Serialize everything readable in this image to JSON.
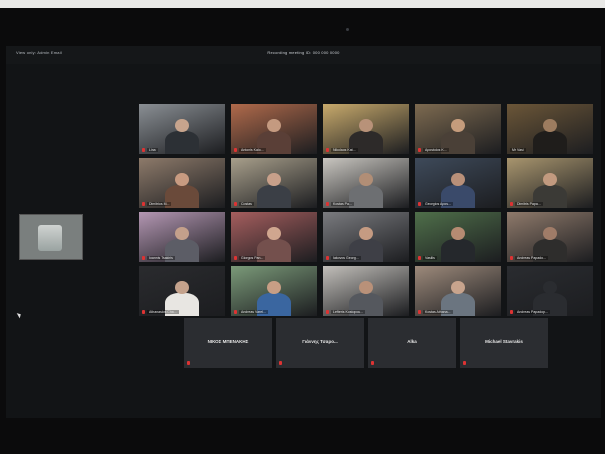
{
  "window": {
    "topbar_left": "View only: Admin Email",
    "topbar_center": "Recording meeting ID: 000 000 0000"
  },
  "tiles": [
    {
      "name": "Lina",
      "muted": true,
      "bg": "#8a8f94",
      "skin": "#c7a48d",
      "shirt": "#2c3035",
      "active": false
    },
    {
      "name": "Antonis Kalo...",
      "muted": true,
      "bg": "#b06a4b",
      "skin": "#c49a80",
      "shirt": "#5a3f37",
      "active": false
    },
    {
      "name": "Nikolaos Kat...",
      "muted": true,
      "bg": "#c8aa6c",
      "skin": "#b89279",
      "shirt": "#2d2a29",
      "active": false
    },
    {
      "name": "Apostolos K...",
      "muted": true,
      "bg": "#7d6a50",
      "skin": "#c59c7c",
      "shirt": "#4a4037",
      "active": false
    },
    {
      "name": "Mr Vasi",
      "muted": false,
      "bg": "#6b5638",
      "skin": "#9d7c5f",
      "shirt": "#1f1d1b",
      "active": true
    },
    {
      "name": "Dimitrios M...",
      "muted": true,
      "bg": "#8d7a6a",
      "skin": "#c89b81",
      "shirt": "#6a4a3a",
      "active": false
    },
    {
      "name": "Costas",
      "muted": true,
      "bg": "#a89f8b",
      "skin": "#c8a08a",
      "shirt": "#3b3f46",
      "active": false
    },
    {
      "name": "Kostas Pa...",
      "muted": true,
      "bg": "#c9c6c0",
      "skin": "#b18e76",
      "shirt": "#6d6f72",
      "active": false
    },
    {
      "name": "Georgios Apos...",
      "muted": true,
      "bg": "#3e4a5a",
      "skin": "#b99079",
      "shirt": "#3a4a6a",
      "active": false
    },
    {
      "name": "Dimitris Papa...",
      "muted": true,
      "bg": "#a8956e",
      "skin": "#c29a7f",
      "shirt": "#3b3a36",
      "active": false
    },
    {
      "name": "Ioannis Tsakiris",
      "muted": true,
      "bg": "#b497b3",
      "skin": "#c4a08b",
      "shirt": "#5c5d66",
      "active": false
    },
    {
      "name": "Giorgos Pan...",
      "muted": true,
      "bg": "#a55e5e",
      "skin": "#d0a68f",
      "shirt": "#74504d",
      "active": false
    },
    {
      "name": "Iakovos Georg...",
      "muted": true,
      "bg": "#7a7b7f",
      "skin": "#c59b82",
      "shirt": "#3e3f46",
      "active": false
    },
    {
      "name": "Vasilis",
      "muted": true,
      "bg": "#4f6f4a",
      "skin": "#b58b72",
      "shirt": "#25282c",
      "active": false
    },
    {
      "name": "Andreas Papado...",
      "muted": true,
      "bg": "#8f7a6b",
      "skin": "#a07c68",
      "shirt": "#2e2d2c",
      "active": false
    },
    {
      "name": "Athanasios Cha...",
      "muted": true,
      "bg": "#2a2b2e",
      "skin": "#c4a28c",
      "shirt": "#e8e6e2",
      "active": false
    },
    {
      "name": "Andreas Varel...",
      "muted": true,
      "bg": "#7b9a79",
      "skin": "#c79e85",
      "shirt": "#3a66a0",
      "active": false
    },
    {
      "name": "Lefteris Kostopou...",
      "muted": true,
      "bg": "#c2bfba",
      "skin": "#b99179",
      "shirt": "#55585e",
      "active": false
    },
    {
      "name": "Kostas Athana...",
      "muted": true,
      "bg": "#9d8a7b",
      "skin": "#c8a48d",
      "shirt": "#6b7580",
      "active": false
    },
    {
      "name": "Andreas Papadop...",
      "muted": true,
      "bg": "#2a2c30",
      "skin": "#2a2c30",
      "shirt": "#2a2c30",
      "active": false
    }
  ],
  "name_tiles": [
    {
      "label": "ΝΙΚΟΣ ΜΠΕΝΑΚΗΣ"
    },
    {
      "label": "Γιάννης Τσαρο..."
    },
    {
      "label": "Alka"
    },
    {
      "label": "Michael Stavrakis"
    }
  ],
  "self_view": {
    "label": ""
  }
}
